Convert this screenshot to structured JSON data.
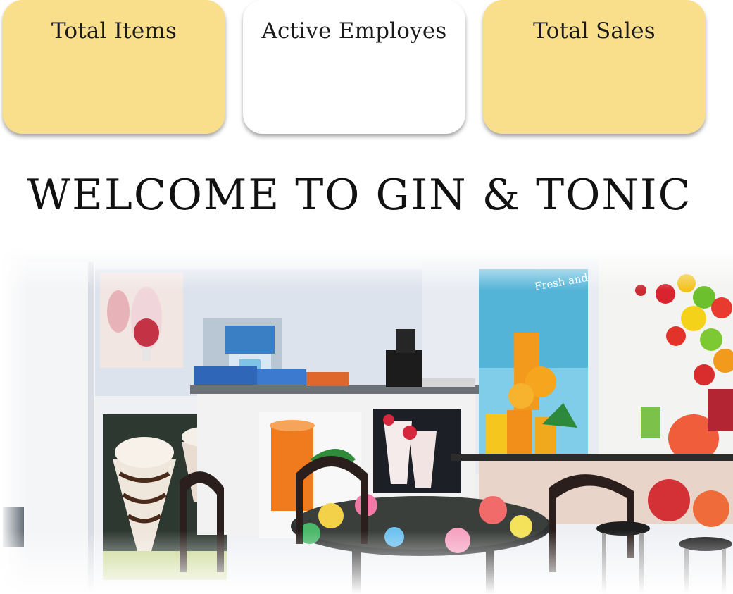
{
  "stats": {
    "total_items_label": "Total Items",
    "active_employees_label": "Active Employes",
    "total_sales_label": "Total Sales"
  },
  "welcome_heading": "WELCOME TO GIN & TONIC",
  "colors": {
    "card_yellow": "#f9df8c",
    "card_white": "#ffffff",
    "text": "#111111"
  },
  "photo": {
    "description_icon": "juice-bar-photo"
  }
}
